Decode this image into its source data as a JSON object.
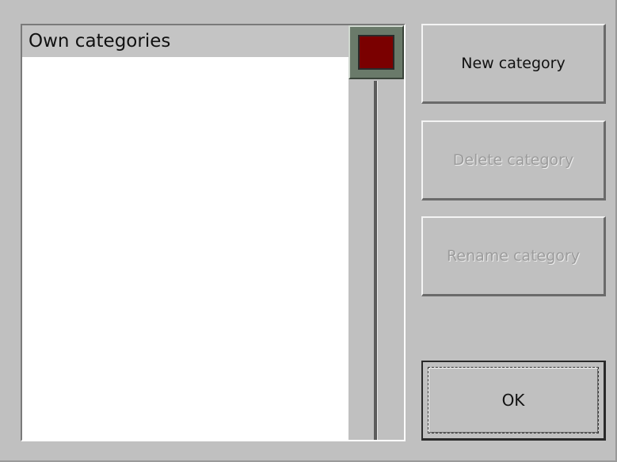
{
  "category_list": {
    "items": [
      {
        "label": "Own categories",
        "selected": true
      }
    ]
  },
  "scrollbar": {
    "thumb_color": "#7a0000"
  },
  "buttons": {
    "new_category": {
      "label": "New category",
      "enabled": true
    },
    "delete_category": {
      "label": "Delete category",
      "enabled": false
    },
    "rename_category": {
      "label": "Rename category",
      "enabled": false
    },
    "ok": {
      "label": "OK",
      "enabled": true,
      "default": true
    }
  }
}
